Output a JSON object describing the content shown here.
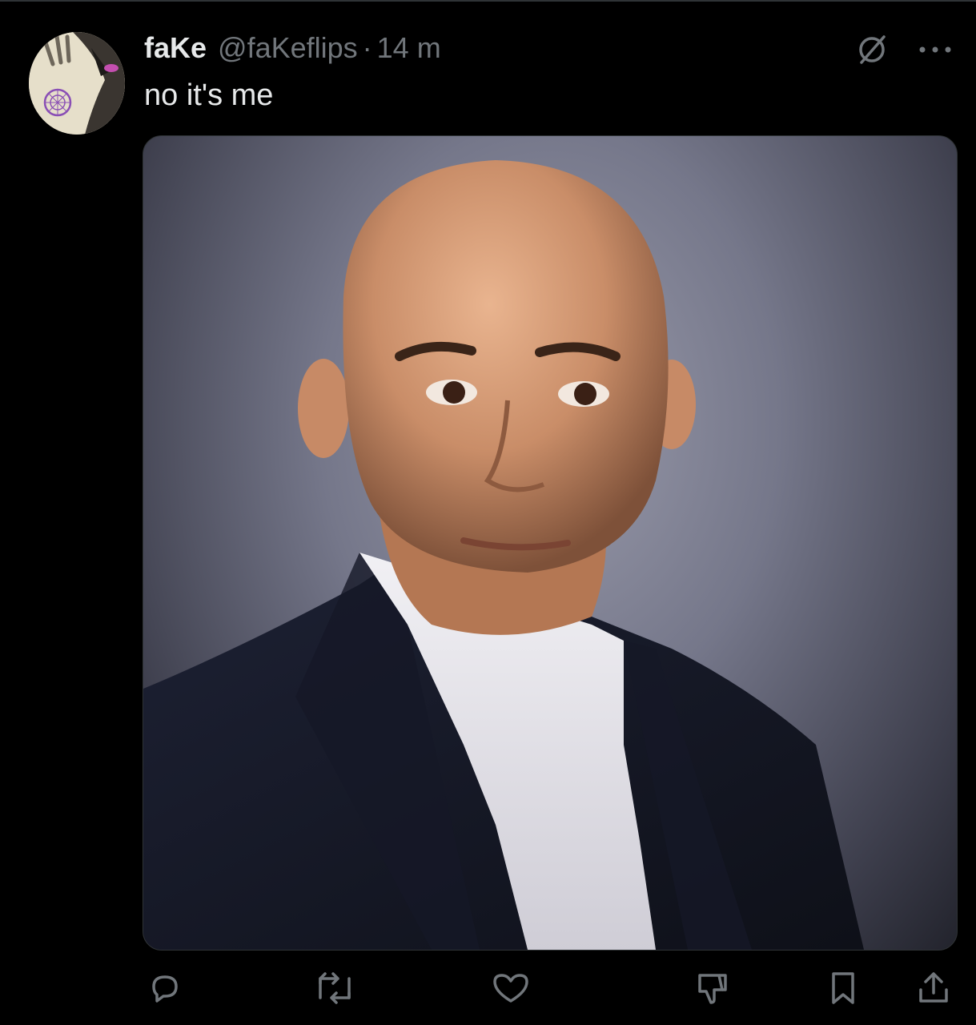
{
  "tweet": {
    "display_name": "faKe",
    "handle": "@faKeflips",
    "separator": "·",
    "time": "14 m",
    "text": "no it's me"
  },
  "icons": {
    "grok": "grok-icon",
    "more": "more-icon",
    "reply": "reply-icon",
    "repost": "repost-icon",
    "like": "like-icon",
    "dislike": "dislike-icon",
    "bookmark": "bookmark-icon",
    "share": "share-icon"
  },
  "colors": {
    "background": "#000000",
    "text": "#e7e9ea",
    "secondary": "#71767b",
    "border": "#2f3336"
  }
}
